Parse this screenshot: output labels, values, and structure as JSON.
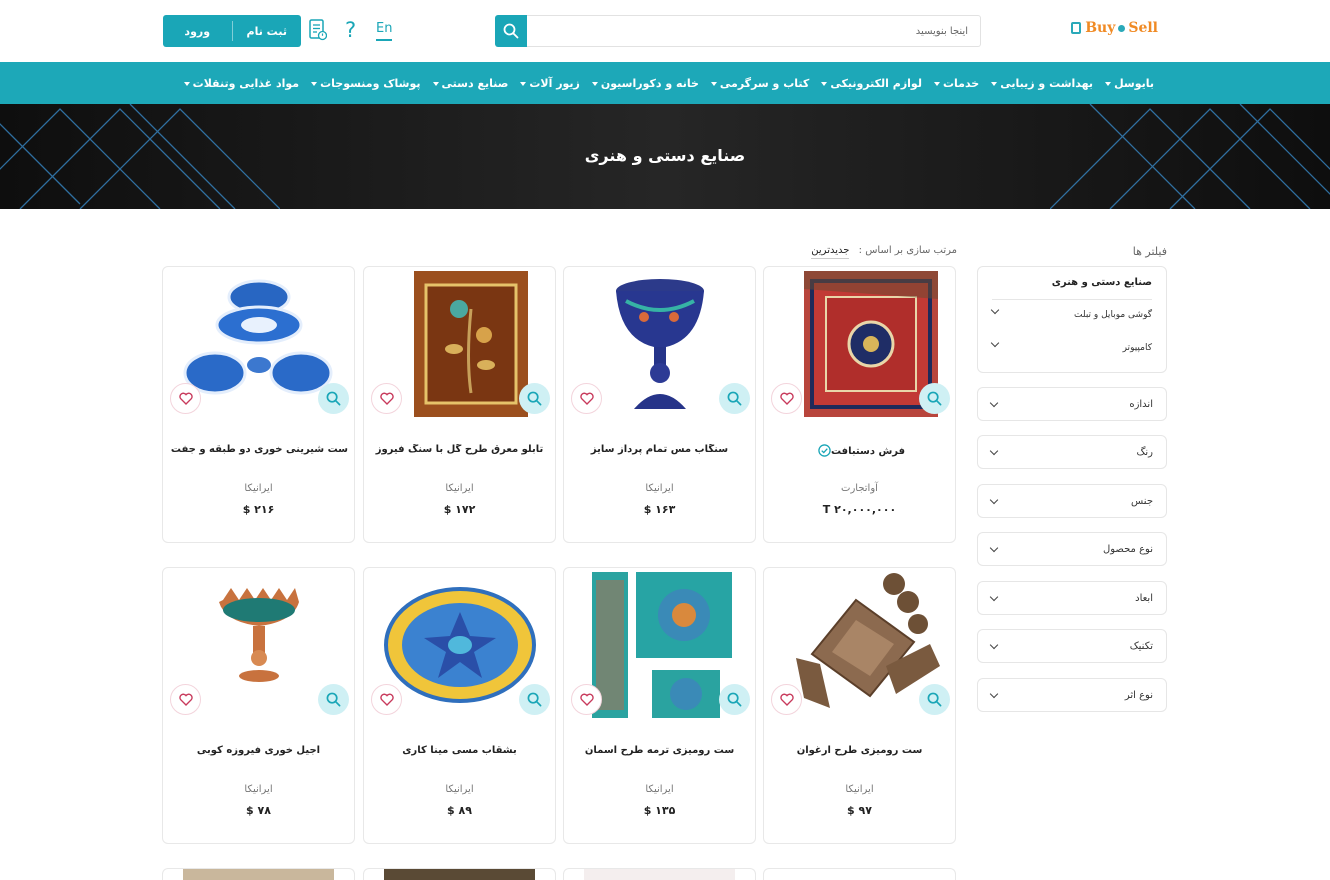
{
  "header": {
    "logo_part1": "Buy",
    "logo_part2": "Sell",
    "search_placeholder": "اینجا بنویسید",
    "lang": "En",
    "help": "?",
    "register_label": "ثبت نام",
    "login_label": "ورود"
  },
  "nav": {
    "items": [
      {
        "label": "مواد غذایی وتنقلات",
        "caret": true
      },
      {
        "label": "پوشاک ومنسوجات",
        "caret": true
      },
      {
        "label": "صنایع دستی",
        "caret": true
      },
      {
        "label": "زیور آلات",
        "caret": true
      },
      {
        "label": "خانه و دکوراسیون",
        "caret": true
      },
      {
        "label": "کتاب و سرگرمی",
        "caret": true
      },
      {
        "label": "لوازم الکترونیکی",
        "caret": true
      },
      {
        "label": "خدمات",
        "caret": true
      },
      {
        "label": "بهداشت و زیبایی",
        "caret": true
      },
      {
        "label": "بایوسل",
        "caret": true
      }
    ]
  },
  "banner": {
    "title": "صنایع دستی و هنری"
  },
  "sidebar": {
    "title": "فیلتر ها",
    "category": {
      "title": "صنایع دستی و هنری",
      "subs": [
        "گوشی موبایل و تبلت",
        "کامپیوتر"
      ]
    },
    "filters": [
      "اندازه",
      "رنگ",
      "جنس",
      "نوع محصول",
      "ابعاد",
      "تکنیک",
      "نوع اثر"
    ]
  },
  "sort": {
    "label": "مرتب سازی بر اساس :",
    "value": "جدیدترین"
  },
  "products": [
    {
      "name": "فرش دستبافت",
      "seller": "آواتجارت",
      "price": "T ۲۰,۰۰۰,۰۰۰",
      "verified": true,
      "icon": "rug-image"
    },
    {
      "name": "سنگاب مس تمام پرداز سایز",
      "seller": "ایرانیکا",
      "price": "$ ۱۶۳",
      "verified": false,
      "icon": "enamel-bowl-image"
    },
    {
      "name": "تابلو معرق طرح گل با سنگ فیروز",
      "seller": "ایرانیکا",
      "price": "$ ۱۷۲",
      "verified": false,
      "icon": "marquetry-panel-image"
    },
    {
      "name": "ست شیرینی خوری دو طبقه و جفت ب",
      "seller": "ایرانیکا",
      "price": "$ ۲۱۶",
      "verified": false,
      "icon": "blue-dish-set-image"
    },
    {
      "name": "ست رومیزی طرح ارغوان",
      "seller": "ایرانیکا",
      "price": "$ ۹۷",
      "verified": false,
      "icon": "table-cloth-set-image"
    },
    {
      "name": "ست رومیزی ترمه طرح آسمان",
      "seller": "ایرانیکا",
      "price": "$ ۱۳۵",
      "verified": false,
      "icon": "termeh-set-image"
    },
    {
      "name": "بشقاب مسی مینا کاری",
      "seller": "ایرانیکا",
      "price": "$ ۸۹",
      "verified": false,
      "icon": "enamel-plate-image"
    },
    {
      "name": "آجیل خوری فیروزه کوبی",
      "seller": "ایرانیکا",
      "price": "$ ۷۸",
      "verified": false,
      "icon": "turquoise-bowl-image"
    }
  ],
  "colors": {
    "accent": "#1aa6b7",
    "nav": "#1da8b8",
    "banner": "#1a1a1a"
  }
}
